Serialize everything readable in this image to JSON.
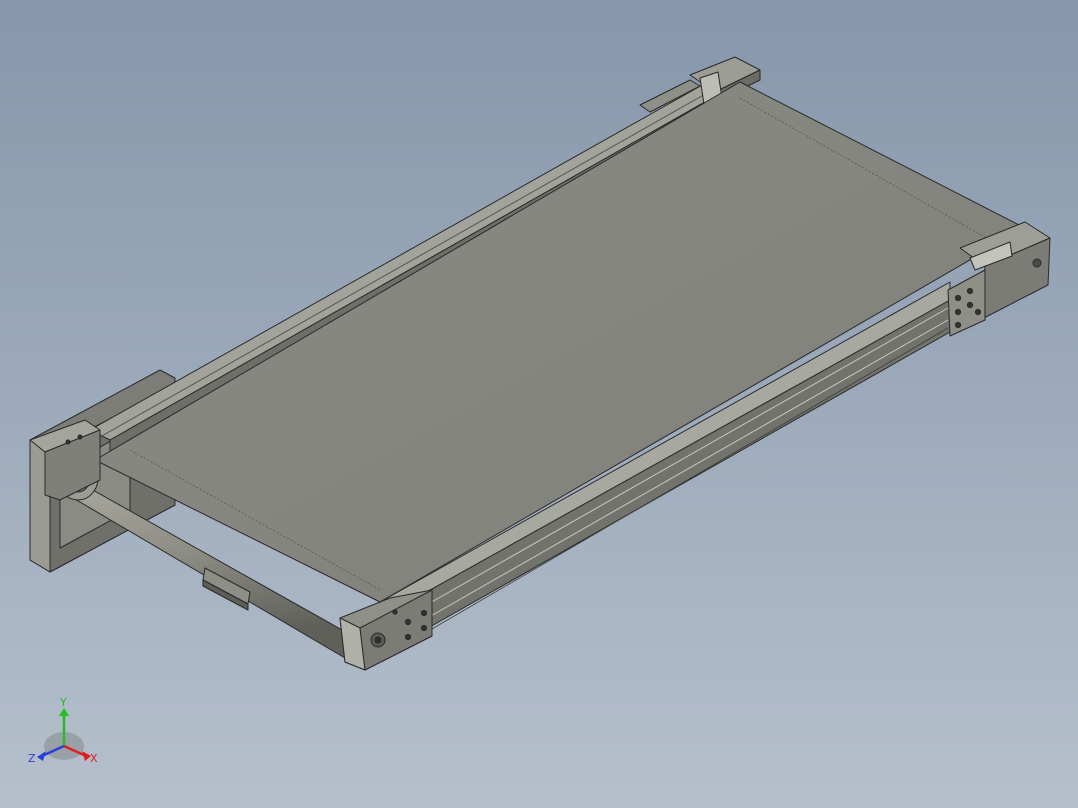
{
  "viewport": {
    "background_top": "#8797ab",
    "background_bottom": "#b6c0cc"
  },
  "model": {
    "name": "belt-conveyor",
    "belt_color": "#868780",
    "frame_color": "#8f9088",
    "shade_color": "#6a6b64",
    "edge_color": "#2a2a2a"
  },
  "triad": {
    "x_label": "X",
    "y_label": "Y",
    "z_label": "Z",
    "x_color": "#e02020",
    "y_color": "#1fbf1f",
    "z_color": "#2a3fd8"
  }
}
